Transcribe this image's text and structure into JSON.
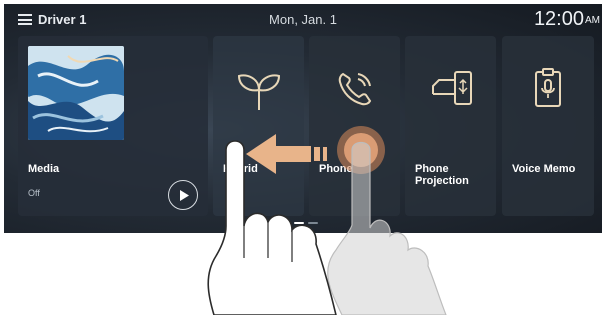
{
  "header": {
    "driver_label": "Driver 1",
    "date": "Mon, Jan. 1",
    "time": "12:00",
    "ampm": "AM"
  },
  "tiles": {
    "media": {
      "label": "Media",
      "sub": "Off"
    },
    "hybrid": {
      "label": "Hybrid"
    },
    "phone": {
      "label": "Phone"
    },
    "projection": {
      "label_line1": "Phone",
      "label_line2": "Projection"
    },
    "voice_memo": {
      "label": "Voice Memo"
    }
  },
  "pagination": {
    "pages": 2,
    "current": 1
  },
  "colors": {
    "screen_bg": "#232b35",
    "tile_bg": "#28303a",
    "icon_accent": "#e8d7b8",
    "text": "#ffffff",
    "arrow": "#e8b48a",
    "touch_ring": "#d88b5a"
  },
  "gesture": {
    "type": "swipe-left",
    "icon": "hand-pointer-icon"
  }
}
